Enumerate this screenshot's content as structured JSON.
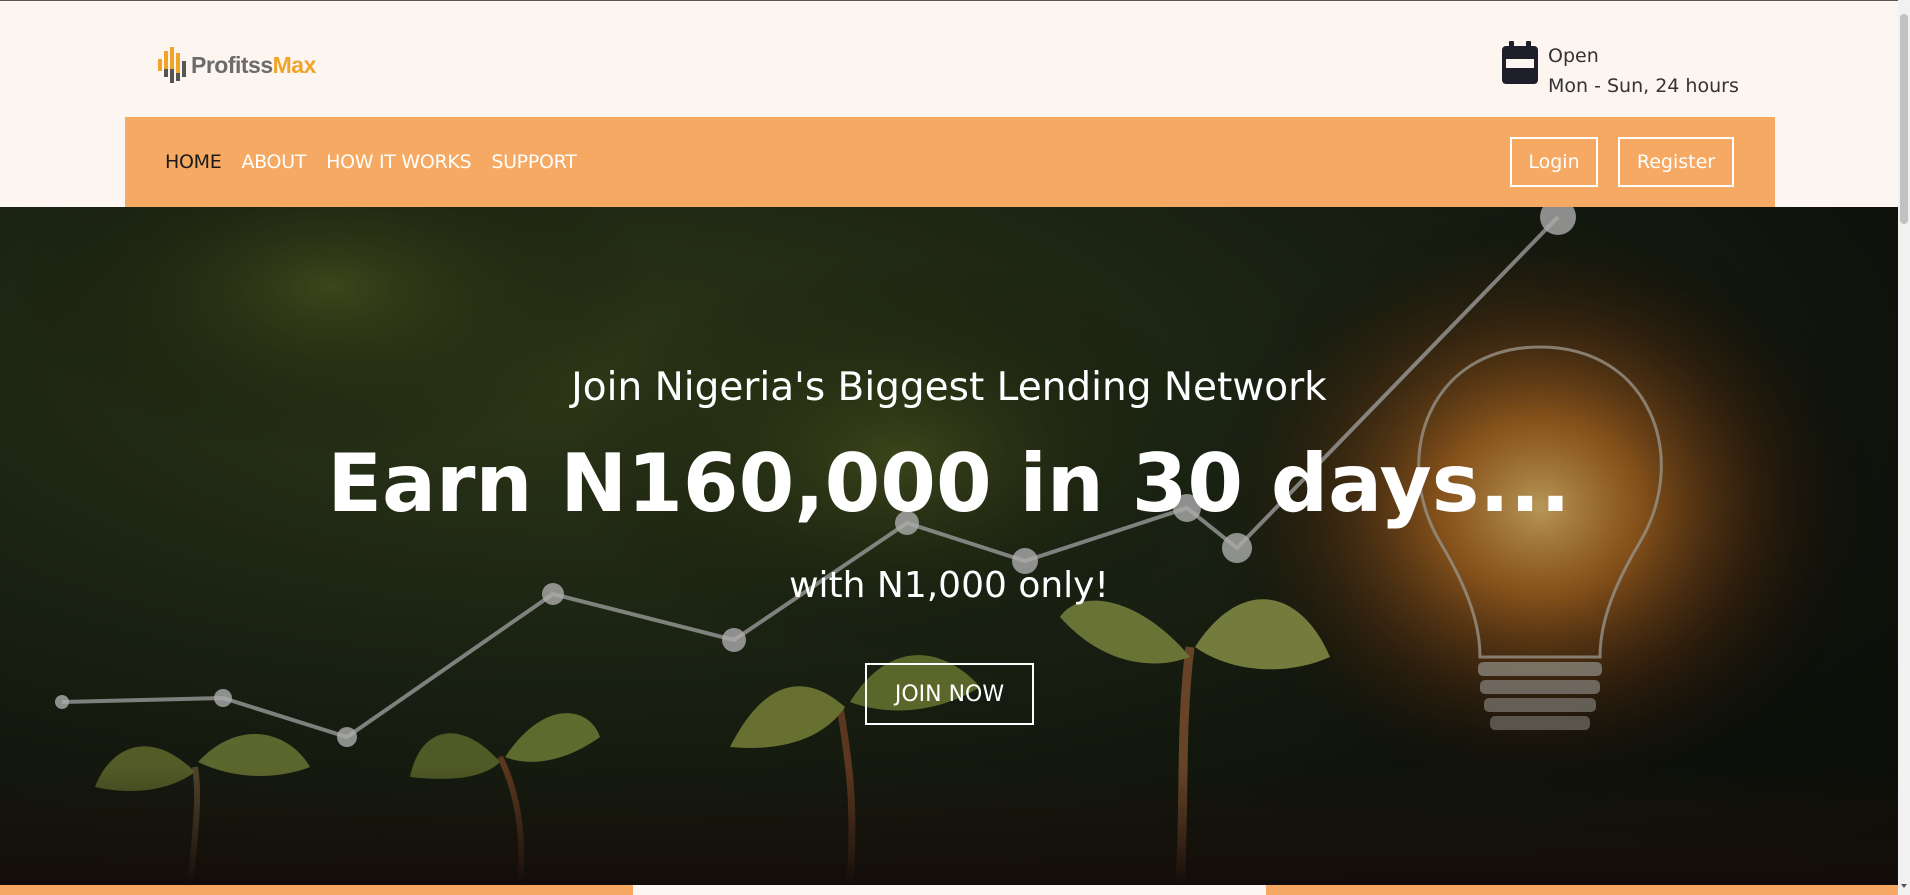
{
  "brand": {
    "name_part1": "Profitss",
    "name_part2": "Max",
    "accent": "#f0a42c"
  },
  "hours": {
    "icon": "calendar-icon",
    "line1": "Open",
    "line2": "Mon - Sun, 24 hours"
  },
  "nav": {
    "items": [
      "HOME",
      "ABOUT",
      "HOW IT WORKS",
      "SUPPORT"
    ],
    "active": "HOME",
    "login_label": "Login",
    "register_label": "Register"
  },
  "hero": {
    "subtitle": "Join Nigeria's Biggest Lending Network",
    "headline": "Earn N160,000 in 30 days...",
    "tagline": "with N1,000 only!",
    "cta_label": "JOIN NOW"
  },
  "colors": {
    "nav_bg": "#f5a962",
    "page_bg": "#fdf5ef"
  }
}
